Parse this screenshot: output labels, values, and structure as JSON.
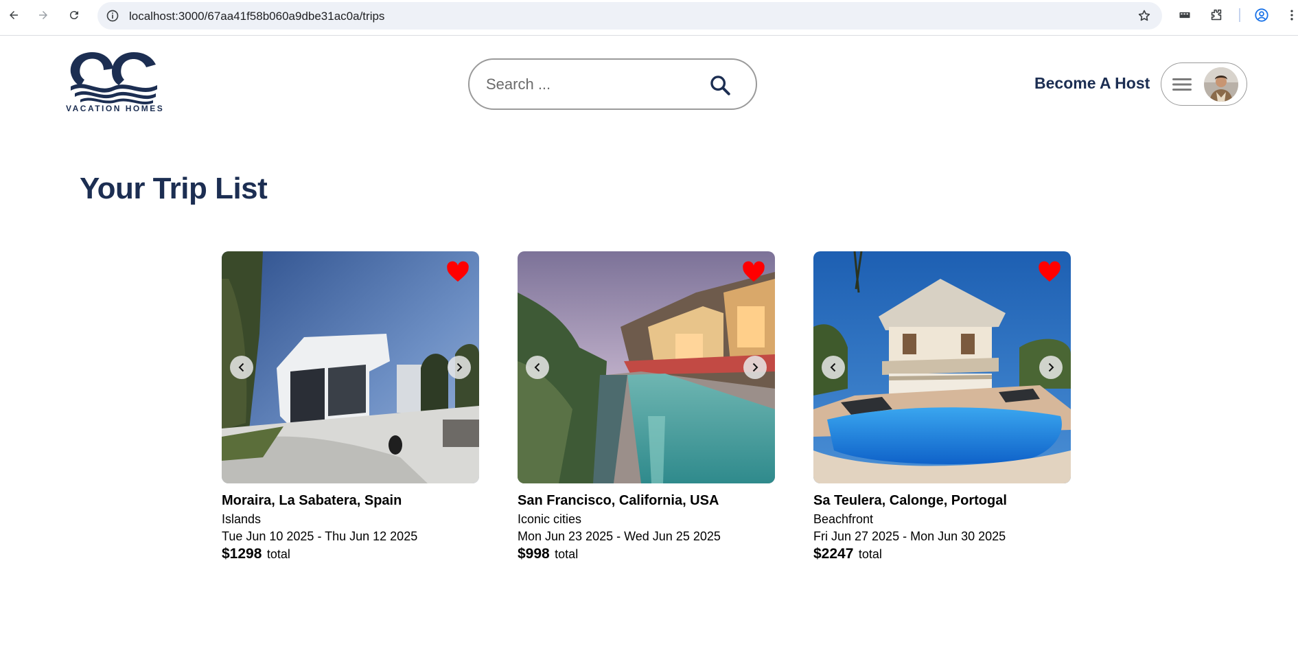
{
  "browser": {
    "url": "localhost:3000/67aa41f58b060a9dbe31ac0a/trips"
  },
  "header": {
    "logo_text": "VACATION HOMES",
    "search_placeholder": "Search ...",
    "become_host_label": "Become A Host"
  },
  "main": {
    "title": "Your Trip List",
    "trips": [
      {
        "location": "Moraira, La Sabatera, Spain",
        "category": "Islands",
        "dates": "Tue Jun 10 2025 - Thu Jun 12 2025",
        "price": "$1298",
        "price_suffix": "total"
      },
      {
        "location": "San Francisco, California, USA",
        "category": "Iconic cities",
        "dates": "Mon Jun 23 2025 - Wed Jun 25 2025",
        "price": "$998",
        "price_suffix": "total"
      },
      {
        "location": "Sa Teulera, Calonge, Portogal",
        "category": "Beachfront",
        "dates": "Fri Jun 27 2025 - Mon Jun 30 2025",
        "price": "$2247",
        "price_suffix": "total"
      }
    ]
  },
  "colors": {
    "brand_navy": "#1c2e52",
    "heart_red": "#ff0000"
  },
  "icons": [
    "back-arrow-icon",
    "forward-arrow-icon",
    "reload-icon",
    "info-icon",
    "star-icon",
    "extension-icon",
    "puzzle-icon",
    "profile-icon",
    "kebab-menu-icon",
    "search-icon",
    "hamburger-menu-icon",
    "heart-icon",
    "chevron-left-icon",
    "chevron-right-icon"
  ]
}
